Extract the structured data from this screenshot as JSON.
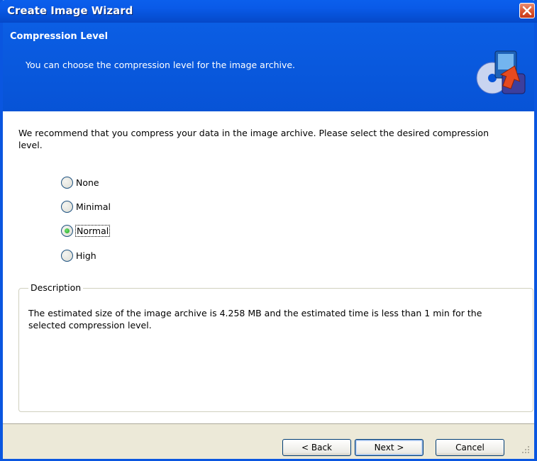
{
  "window": {
    "title": "Create Image Wizard"
  },
  "header": {
    "title": "Compression Level",
    "subtitle": "You can choose the compression level for the image archive."
  },
  "intro": "We recommend that you compress your data in the image archive. Please select the desired compression level.",
  "compression": {
    "options": [
      {
        "label": "None",
        "mnemonic": "o",
        "selected": false
      },
      {
        "label": "Minimal",
        "mnemonic": "l",
        "selected": false
      },
      {
        "label": "Normal",
        "mnemonic": "N",
        "selected": true
      },
      {
        "label": "High",
        "mnemonic": "g",
        "selected": false
      }
    ]
  },
  "description": {
    "legend": "Description",
    "text": "The estimated size of the image archive is 4.258 MB and the estimated time is less than 1 min for the selected compression level."
  },
  "buttons": {
    "back": "< Back",
    "next": "Next >",
    "cancel": "Cancel"
  },
  "colors": {
    "title_blue": "#0a56e0",
    "close_red": "#d9532e",
    "radio_selected": "#21a121"
  },
  "icons": {
    "close": "close-icon",
    "wizard": "disk-image-icon"
  }
}
